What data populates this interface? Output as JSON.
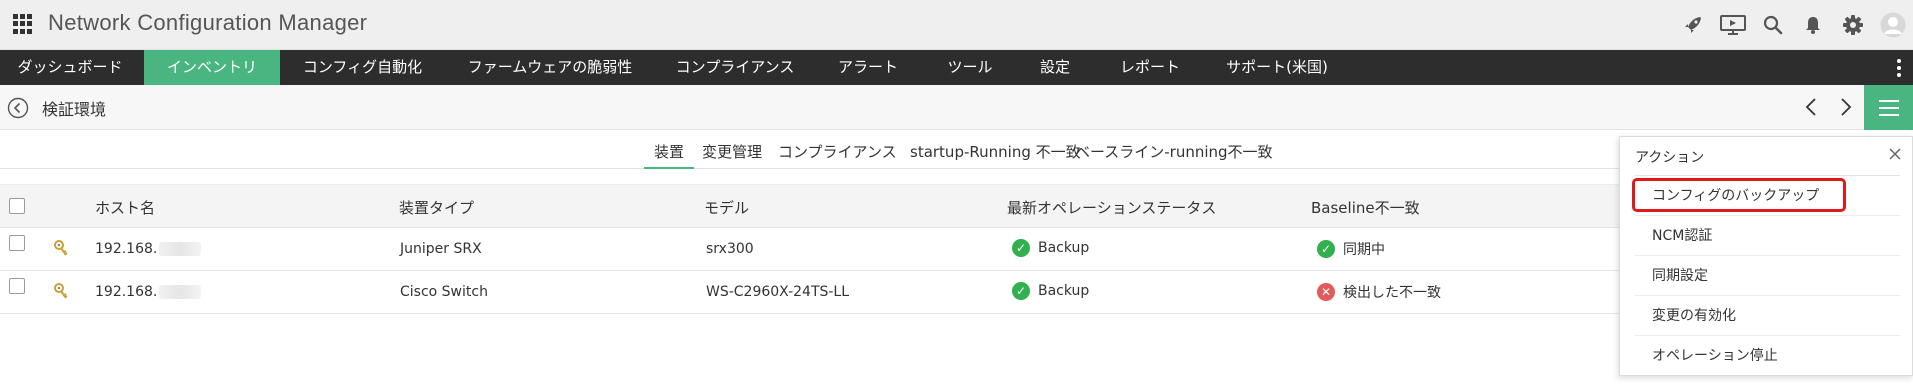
{
  "app": {
    "title": "Network Configuration Manager"
  },
  "header_icons": [
    "rocket-icon",
    "screen-icon",
    "search-icon",
    "bell-icon",
    "gear-icon",
    "user-avatar-icon"
  ],
  "nav": {
    "items": [
      {
        "label": "ダッシュボード",
        "active": false
      },
      {
        "label": "インベントリ",
        "active": true
      },
      {
        "label": "コンフィグ自動化",
        "active": false
      },
      {
        "label": "ファームウェアの脆弱性",
        "active": false
      },
      {
        "label": "コンプライアンス",
        "active": false
      },
      {
        "label": "アラート",
        "active": false
      },
      {
        "label": "ツール",
        "active": false
      },
      {
        "label": "設定",
        "active": false
      },
      {
        "label": "レポート",
        "active": false
      },
      {
        "label": "サポート(米国)",
        "active": false
      }
    ]
  },
  "subheader": {
    "title": "検証環境"
  },
  "tabs": [
    {
      "label": "装置",
      "active": true
    },
    {
      "label": "変更管理",
      "active": false
    },
    {
      "label": "コンプライアンス",
      "active": false
    },
    {
      "label": "startup-Running 不一致",
      "active": false
    },
    {
      "label": "ベースライン-running不一致",
      "active": false
    }
  ],
  "table": {
    "headers": [
      "ホスト名",
      "装置タイプ",
      "モデル",
      "最新オペレーションステータス",
      "Baseline不一致"
    ],
    "rows": [
      {
        "host": "192.168.",
        "type": "Juniper SRX",
        "model": "srx300",
        "op_status": "Backup",
        "op_status_state": "ok",
        "baseline": "同期中",
        "baseline_state": "ok"
      },
      {
        "host": "192.168.",
        "type": "Cisco Switch",
        "model": "WS-C2960X-24TS-LL",
        "op_status": "Backup",
        "op_status_state": "ok",
        "baseline": "検出した不一致",
        "baseline_state": "error"
      }
    ]
  },
  "action_panel": {
    "title": "アクション",
    "items": [
      "コンフィグのバックアップ",
      "NCM認証",
      "同期設定",
      "変更の有効化",
      "オペレーション停止"
    ],
    "highlighted_index": 0
  },
  "colors": {
    "accent": "#49b681",
    "nav_bg": "#2d2d2d",
    "highlight": "#e01a1a",
    "ok": "#33b04e",
    "error": "#e35a5a"
  }
}
